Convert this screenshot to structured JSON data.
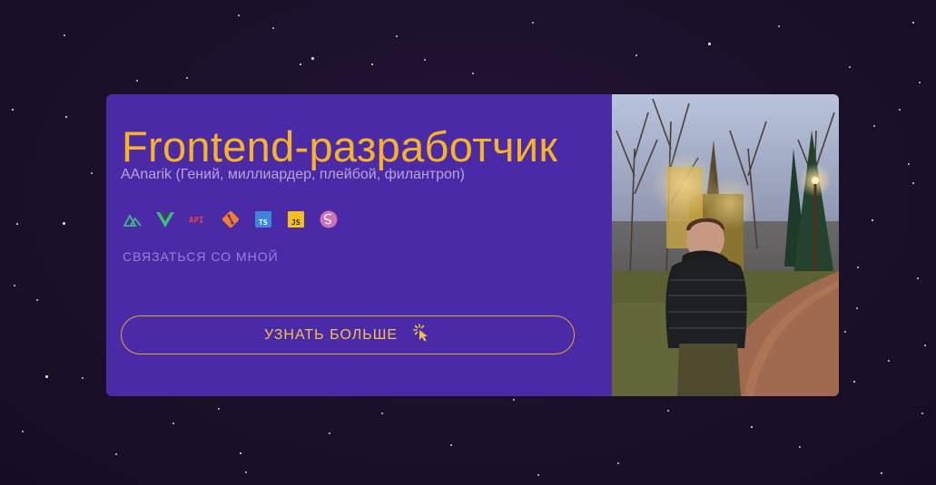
{
  "card": {
    "title": "Frontend-разработчик",
    "subtitle": "AAnarik (Гений, миллиардер, плейбой, филантроп)",
    "contact_link": "СВЯЗАТЬСЯ СО МНОЙ",
    "more_button": "УЗНАТЬ БОЛЬШЕ"
  },
  "tech_icons": [
    {
      "name": "nuxt-icon",
      "color": "#3fb883"
    },
    {
      "name": "vue-icon",
      "color": "#41b883"
    },
    {
      "name": "api-icon",
      "label": "API",
      "color": "#e8433d"
    },
    {
      "name": "git-icon",
      "color": "#f0802b"
    },
    {
      "name": "typescript-icon",
      "label": "TS",
      "color": "#3c86e0"
    },
    {
      "name": "javascript-icon",
      "label": "JS",
      "color": "#f2c11e"
    },
    {
      "name": "sass-icon",
      "color": "#cd73b9"
    }
  ],
  "colors": {
    "background": "#1c1230",
    "card": "#4b2aa8",
    "accent": "#f6b325",
    "muted_text": "#b5a4d6"
  }
}
